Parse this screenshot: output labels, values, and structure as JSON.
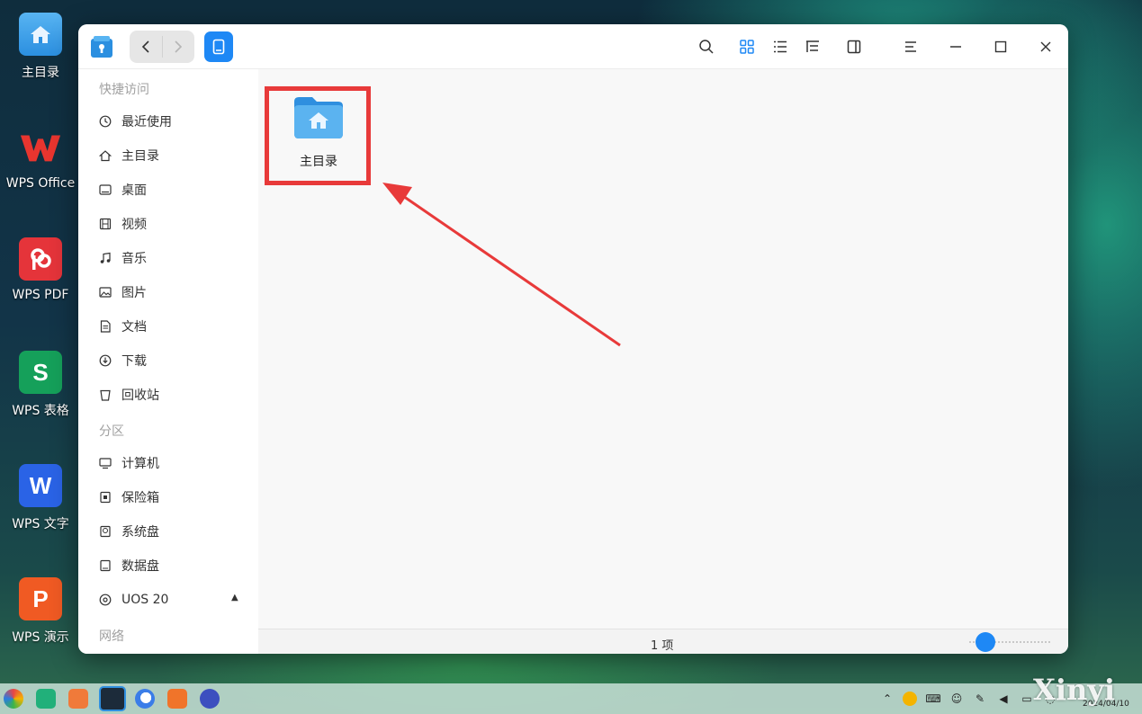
{
  "desktop": {
    "icons": [
      {
        "label": "主目录"
      },
      {
        "label": "WPS Office"
      },
      {
        "label": "WPS PDF"
      },
      {
        "label": "WPS 表格"
      },
      {
        "label": "WPS 文字"
      },
      {
        "label": "WPS 演示"
      }
    ]
  },
  "window": {
    "sidebar": {
      "quick_access_title": "快捷访问",
      "quick_access": [
        {
          "label": "最近使用",
          "icon": "clock-icon"
        },
        {
          "label": "主目录",
          "icon": "home-icon"
        },
        {
          "label": "桌面",
          "icon": "desktop-icon"
        },
        {
          "label": "视频",
          "icon": "video-icon"
        },
        {
          "label": "音乐",
          "icon": "music-icon"
        },
        {
          "label": "图片",
          "icon": "picture-icon"
        },
        {
          "label": "文档",
          "icon": "document-icon"
        },
        {
          "label": "下载",
          "icon": "download-icon"
        },
        {
          "label": "回收站",
          "icon": "trash-icon"
        }
      ],
      "partitions_title": "分区",
      "partitions": [
        {
          "label": "计算机",
          "icon": "computer-icon"
        },
        {
          "label": "保险箱",
          "icon": "vault-icon"
        },
        {
          "label": "系统盘",
          "icon": "system-disk-icon"
        },
        {
          "label": "数据盘",
          "icon": "data-disk-icon"
        },
        {
          "label": "UOS 20",
          "icon": "optical-disc-icon"
        }
      ],
      "network_title": "网络"
    },
    "content": {
      "items": [
        {
          "name": "主目录",
          "icon": "home-folder-icon"
        }
      ]
    },
    "status": {
      "count_text": "1 项",
      "zoom_level": 0.1
    }
  },
  "taskbar": {
    "date_text": "2024/04/10",
    "watermark": "Xinyi"
  },
  "colors": {
    "accent": "#1e88f5",
    "highlight": "#e83a3a"
  }
}
